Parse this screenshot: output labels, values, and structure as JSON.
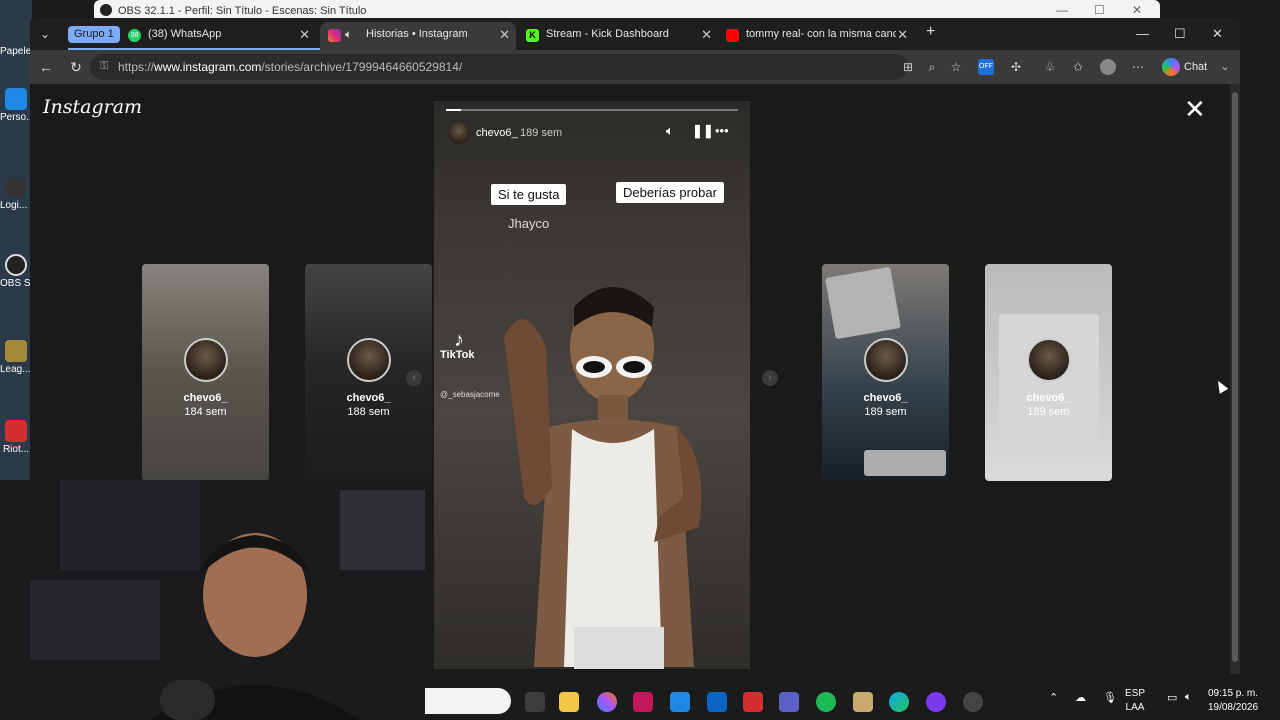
{
  "obs": {
    "title": "OBS 32.1.1 - Perfil: Sin Título - Escenas: Sin Título"
  },
  "desktop_icons": [
    {
      "label": "Papelera de recic..."
    },
    {
      "label": "Perso... Ed..."
    },
    {
      "label": "Logi... H..."
    },
    {
      "label": "OBS S..."
    },
    {
      "label": "Leag... Leg..."
    },
    {
      "label": "Riot..."
    }
  ],
  "browser": {
    "tab_group": "Grupo 1",
    "tabs": [
      {
        "label": "(38) WhatsApp",
        "badge": "38",
        "icon": "whatsapp-icon",
        "color": "#25d366"
      },
      {
        "label": "Historias • Instagram",
        "icon": "instagram-icon",
        "color": "#e1306c",
        "audio": "speaker-icon"
      },
      {
        "label": "Stream - Kick Dashboard",
        "icon": "kick-icon",
        "color": "#53fc18"
      },
      {
        "label": "tommy real- con la misma cancion...",
        "icon": "youtube-icon",
        "color": "#ff0000"
      }
    ],
    "url": {
      "prefix": "https://",
      "host": "www.instagram.com",
      "path": "/stories/archive/17999464660529814/"
    },
    "chat_label": "Chat"
  },
  "instagram": {
    "logo": "Instagram",
    "story": {
      "username": "chevo6_",
      "time": "189 sem",
      "progress": 0.05,
      "sticker1": "Si te gusta",
      "sticker2": "Deberías probar",
      "artist": "Jhayco",
      "tiktok_label": "TikTok",
      "tiktok_user": "@_sebasjacome"
    },
    "previews": [
      {
        "username": "chevo6_",
        "time": "184 sem"
      },
      {
        "username": "chevo6_",
        "time": "188 sem"
      },
      {
        "username": "chevo6_",
        "time": "189 sem"
      },
      {
        "username": "chevo6_",
        "time": "189 sem"
      }
    ]
  },
  "taskbar": {
    "lang_top": "ESP",
    "lang_bottom": "LAA",
    "time": "09:15 p. m.",
    "date": "19/08/2026"
  }
}
